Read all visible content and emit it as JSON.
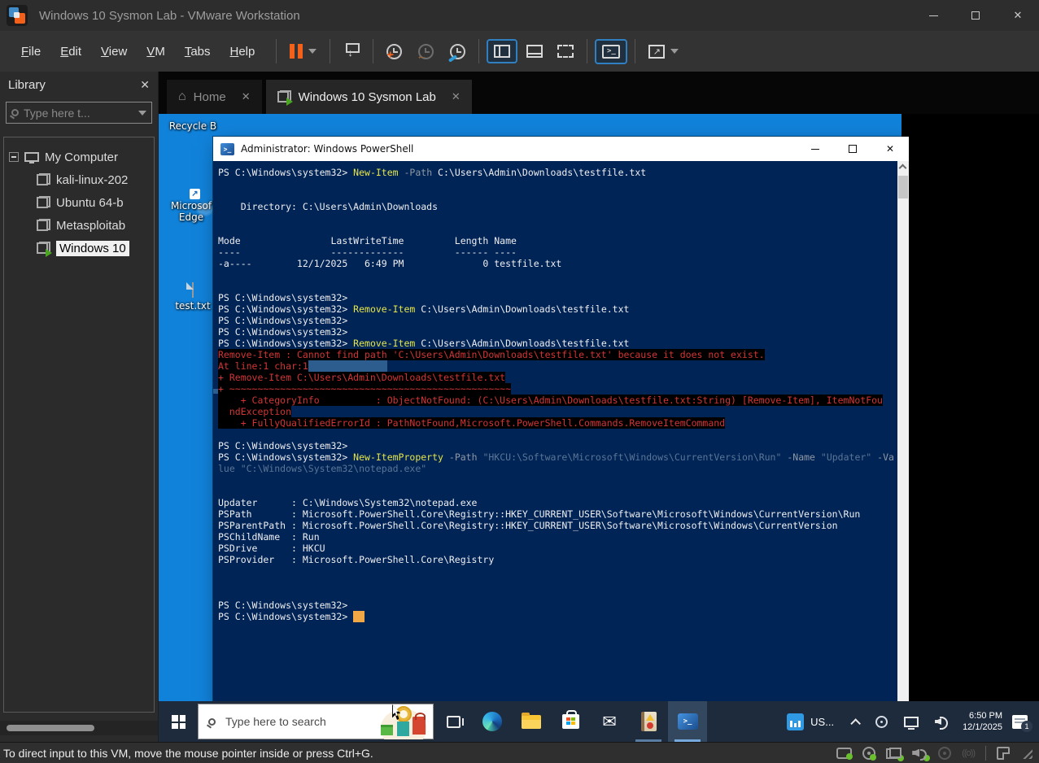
{
  "vmware": {
    "title": "Windows 10 Sysmon Lab - VMware Workstation",
    "menu": [
      "File",
      "Edit",
      "View",
      "VM",
      "Tabs",
      "Help"
    ],
    "status_message": "To direct input to this VM, move the mouse pointer inside or press Ctrl+G.",
    "library": {
      "header": "Library",
      "search_placeholder": "Type here t...",
      "tree_root": "My Computer",
      "vms": [
        {
          "label": "kali-linux-202",
          "state": "stopped",
          "selected": false
        },
        {
          "label": "Ubuntu 64-b",
          "state": "stopped",
          "selected": false
        },
        {
          "label": "Metasploitab",
          "state": "stopped",
          "selected": false
        },
        {
          "label": "Windows 10",
          "state": "running",
          "selected": true
        }
      ]
    },
    "tabs": [
      {
        "label": "Home",
        "active": false
      },
      {
        "label": "Windows 10 Sysmon Lab",
        "active": true
      }
    ]
  },
  "guest": {
    "desktop_icons": [
      {
        "name": "recycle-bin",
        "label": "Recycle B"
      },
      {
        "name": "microsoft-edge",
        "label_line1": "Microsof",
        "label_line2": "Edge"
      },
      {
        "name": "test-txt",
        "label": "test.txt"
      }
    ],
    "taskbar": {
      "search_placeholder": "Type here to search",
      "tray_language": "US...",
      "clock_time": "6:50 PM",
      "clock_date": "12/1/2025",
      "notification_count": "1"
    },
    "powershell": {
      "title": "Administrator: Windows PowerShell",
      "lines": [
        [
          [
            "w",
            "PS C:\\Windows\\system32> "
          ],
          [
            "y",
            "New-Item"
          ],
          [
            "w",
            " "
          ],
          [
            "p",
            "-Path"
          ],
          [
            "w",
            " C:\\Users\\Admin\\Downloads\\testfile.txt"
          ]
        ],
        [],
        [],
        [
          [
            "w",
            "    Directory: C:\\Users\\Admin\\Downloads"
          ]
        ],
        [],
        [],
        [
          [
            "w",
            "Mode                LastWriteTime         Length Name"
          ]
        ],
        [
          [
            "w",
            "----                -------------         ------ ----"
          ]
        ],
        [
          [
            "w",
            "-a----        12/1/2025   6:49 PM              0 testfile.txt"
          ]
        ],
        [],
        [],
        [
          [
            "w",
            "PS C:\\Windows\\system32>"
          ]
        ],
        [
          [
            "w",
            "PS C:\\Windows\\system32> "
          ],
          [
            "y",
            "Remove-Item"
          ],
          [
            "w",
            " C:\\Users\\Admin\\Downloads\\testfile.txt"
          ]
        ],
        [
          [
            "w",
            "PS C:\\Windows\\system32>"
          ]
        ],
        [
          [
            "w",
            "PS C:\\Windows\\system32>"
          ]
        ],
        [
          [
            "w",
            "PS C:\\Windows\\system32> "
          ],
          [
            "y",
            "Remove-Item"
          ],
          [
            "w",
            " C:\\Users\\Admin\\Downloads\\testfile.txt"
          ]
        ],
        [
          [
            "e",
            "Remove-Item : Cannot find path 'C:\\Users\\Admin\\Downloads\\testfile.txt' because it does not exist."
          ]
        ],
        [
          [
            "e",
            "At line:1 char:1"
          ],
          [
            "sel",
            "              "
          ]
        ],
        [
          [
            "e",
            "+ Remove-Item C:\\Users\\Admin\\Downloads\\testfile.txt"
          ]
        ],
        [
          [
            "e",
            "+ ~~~~~~~~~~~~~~~~~~~~~~~~~~~~~~~~~~~~~~~~~~~~~~~~~~"
          ]
        ],
        [
          [
            "e",
            "    + CategoryInfo          : ObjectNotFound: (C:\\Users\\Admin\\Downloads\\testfile.txt:String) [Remove-Item], ItemNotFou"
          ]
        ],
        [
          [
            "e",
            "  ndException"
          ]
        ],
        [
          [
            "e",
            "    + FullyQualifiedErrorId : PathNotFound,Microsoft.PowerShell.Commands.RemoveItemCommand"
          ]
        ],
        [],
        [
          [
            "w",
            "PS C:\\Windows\\system32>"
          ]
        ],
        [
          [
            "w",
            "PS C:\\Windows\\system32> "
          ],
          [
            "y",
            "New-ItemProperty"
          ],
          [
            "w",
            " "
          ],
          [
            "p",
            "-Path"
          ],
          [
            "w",
            " "
          ],
          [
            "s",
            "\"HKCU:\\Software\\Microsoft\\Windows\\CurrentVersion\\Run\""
          ],
          [
            "w",
            " "
          ],
          [
            "p",
            "-Name"
          ],
          [
            "w",
            " "
          ],
          [
            "s",
            "\"Updater\""
          ],
          [
            "w",
            " "
          ],
          [
            "p",
            "-Va"
          ]
        ],
        [
          [
            "s",
            "lue \"C:\\Windows\\System32\\notepad.exe\""
          ]
        ],
        [],
        [],
        [
          [
            "w",
            "Updater      : C:\\Windows\\System32\\notepad.exe"
          ]
        ],
        [
          [
            "w",
            "PSPath       : Microsoft.PowerShell.Core\\Registry::HKEY_CURRENT_USER\\Software\\Microsoft\\Windows\\CurrentVersion\\Run"
          ]
        ],
        [
          [
            "w",
            "PSParentPath : Microsoft.PowerShell.Core\\Registry::HKEY_CURRENT_USER\\Software\\Microsoft\\Windows\\CurrentVersion"
          ]
        ],
        [
          [
            "w",
            "PSChildName  : Run"
          ]
        ],
        [
          [
            "w",
            "PSDrive      : HKCU"
          ]
        ],
        [
          [
            "w",
            "PSProvider   : Microsoft.PowerShell.Core\\Registry"
          ]
        ],
        [],
        [],
        [],
        [
          [
            "w",
            "PS C:\\Windows\\system32>"
          ]
        ],
        [
          [
            "w",
            "PS C:\\Windows\\system32> "
          ],
          [
            "cur",
            "  "
          ]
        ]
      ]
    }
  },
  "icons": {
    "close": "✕",
    "home": "⌂",
    "mail": "✉",
    "prompt": ">_",
    "recycle": "♻",
    "fit": "↗",
    "shortcut_arrow": "↗",
    "signal": "((o))"
  },
  "colors": {
    "desktop_blue": "#1182da",
    "console_bg": "#012456",
    "console_text": "#eeeef0",
    "command_yellow": "#e5e54a",
    "param_gray": "#8f98a3",
    "string_blue": "#5a7596",
    "error_red": "#d13535",
    "selection_blue": "#2d5c8e",
    "cursor_orange": "#f0a847",
    "taskbar_bg": "#1e2b3d",
    "accent_green": "#6abf2d",
    "vmware_orange": "#f2601a",
    "chrome_dark": "#2d2d2d"
  }
}
